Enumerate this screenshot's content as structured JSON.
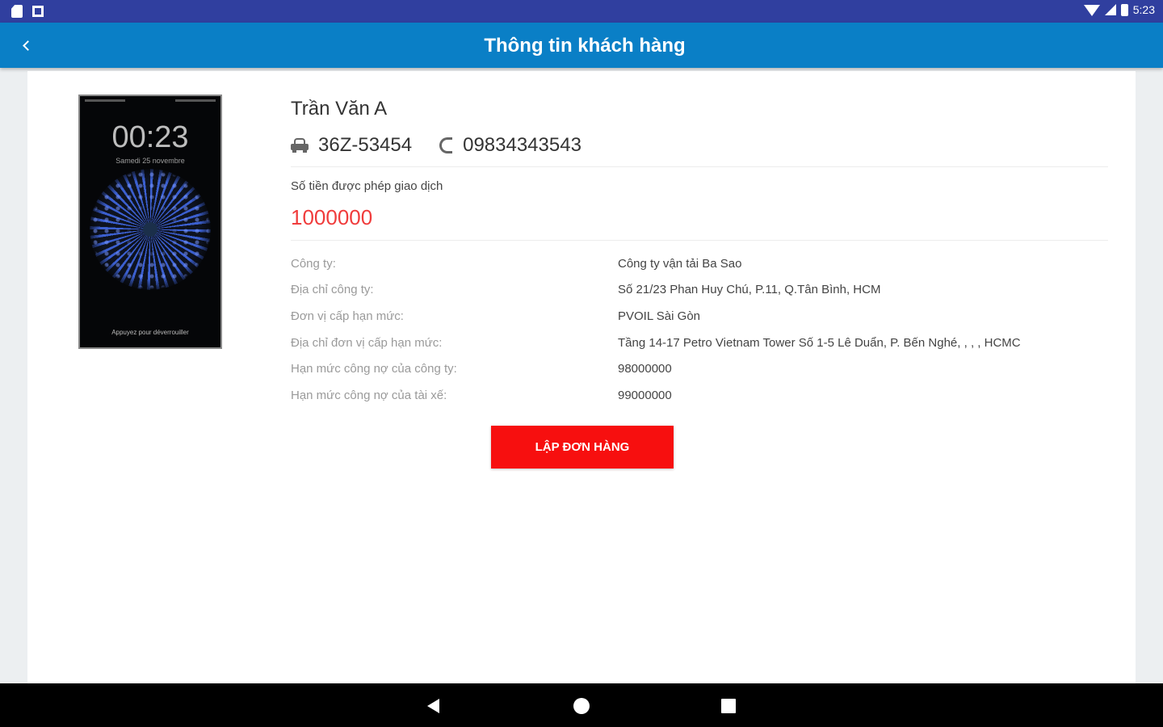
{
  "status_bar": {
    "time": "5:23",
    "icons": [
      "sd-card-icon",
      "square-notification-icon",
      "wifi-icon",
      "signal-icon",
      "battery-icon"
    ]
  },
  "app_bar": {
    "title": "Thông tin khách hàng",
    "back_icon": "chevron-left-icon",
    "color": "#0a7fc6"
  },
  "customer": {
    "name": "Trần Văn A",
    "plate": "36Z-53454",
    "phone": "09834343543",
    "plate_icon": "car-icon",
    "phone_icon": "phone-icon",
    "photo": {
      "time": "00:23",
      "date": "Samedi 25 novembre",
      "unlock_hint": "Appuyez pour déverrouiller"
    }
  },
  "allowance": {
    "label": "Số tiền được phép giao dịch",
    "value": "1000000",
    "color": "#f03c3c"
  },
  "details": [
    {
      "label": "Công ty:",
      "value": "Công ty vận tải Ba Sao"
    },
    {
      "label": "Địa chỉ công ty:",
      "value": "Số 21/23 Phan Huy Chú, P.11, Q.Tân Bình, HCM"
    },
    {
      "label": "Đơn vị cấp hạn mức:",
      "value": "PVOIL Sài Gòn"
    },
    {
      "label": "Địa chỉ đơn vị cấp hạn mức:",
      "value": "Tầng 14-17 Petro Vietnam Tower Số 1-5 Lê Duẩn, P. Bến Nghé, , , , HCMC"
    },
    {
      "label": "Hạn mức công nợ của công ty:",
      "value": "98000000"
    },
    {
      "label": "Hạn mức công nợ của tài xế:",
      "value": "99000000"
    }
  ],
  "actions": {
    "create_order_label": "LẬP ĐƠN HÀNG",
    "button_color": "#f70f0f"
  },
  "nav_bar": {
    "icons": [
      "nav-back-icon",
      "nav-home-icon",
      "nav-recents-icon"
    ]
  }
}
